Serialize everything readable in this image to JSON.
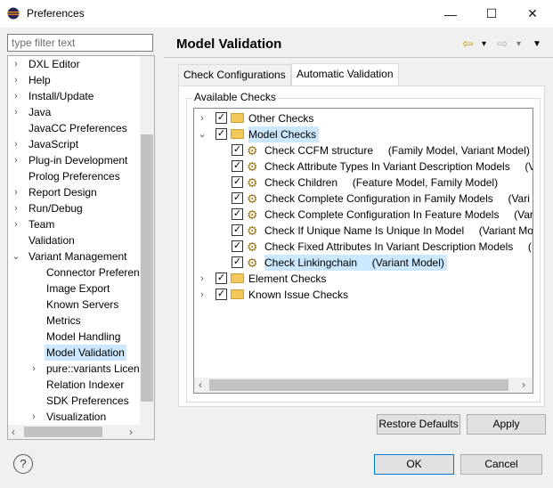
{
  "window": {
    "title": "Preferences",
    "minimize_glyph": "—",
    "maximize_glyph": "☐",
    "close_glyph": "✕"
  },
  "filter": {
    "placeholder": "type filter text"
  },
  "nav_tree": [
    {
      "label": "DXL Editor",
      "chevron": "›"
    },
    {
      "label": "Help",
      "chevron": "›"
    },
    {
      "label": "Install/Update",
      "chevron": "›"
    },
    {
      "label": "Java",
      "chevron": "›"
    },
    {
      "label": "JavaCC Preferences",
      "chevron": ""
    },
    {
      "label": "JavaScript",
      "chevron": "›"
    },
    {
      "label": "Plug-in Development",
      "chevron": "›"
    },
    {
      "label": "Prolog Preferences",
      "chevron": ""
    },
    {
      "label": "Report Design",
      "chevron": "›"
    },
    {
      "label": "Run/Debug",
      "chevron": "›"
    },
    {
      "label": "Team",
      "chevron": "›"
    },
    {
      "label": "Validation",
      "chevron": ""
    },
    {
      "label": "Variant Management",
      "chevron": "⌄"
    },
    {
      "label": "Connector Preferenc",
      "chevron": ""
    },
    {
      "label": "Image Export",
      "chevron": ""
    },
    {
      "label": "Known Servers",
      "chevron": ""
    },
    {
      "label": "Metrics",
      "chevron": ""
    },
    {
      "label": "Model Handling",
      "chevron": ""
    },
    {
      "label": "Model Validation",
      "chevron": ""
    },
    {
      "label": "pure::variants Licens",
      "chevron": "›"
    },
    {
      "label": "Relation Indexer",
      "chevron": ""
    },
    {
      "label": "SDK Preferences",
      "chevron": ""
    },
    {
      "label": "Visualization",
      "chevron": "›"
    }
  ],
  "page": {
    "title": "Model Validation"
  },
  "nav_icons": {
    "back": "⇦",
    "back_menu": "▾",
    "forward": "⇨",
    "forward_menu": "▾",
    "view_menu": "▼"
  },
  "tabs": [
    {
      "label": "Check Configurations"
    },
    {
      "label": "Automatic Validation"
    }
  ],
  "group": {
    "label": "Available Checks"
  },
  "checks_tree": [
    {
      "label": "Other Checks",
      "kind": "folder",
      "chevron": "›",
      "checked": true
    },
    {
      "label": "Model Checks",
      "kind": "folder",
      "chevron": "⌄",
      "checked": true
    },
    {
      "label": "Check CCFM structure     (Family Model, Variant Model)",
      "kind": "check",
      "checked": true
    },
    {
      "label": "Check Attribute Types In Variant Description Models     (V",
      "kind": "check",
      "checked": true
    },
    {
      "label": "Check Children     (Feature Model, Family Model)",
      "kind": "check",
      "checked": true
    },
    {
      "label": "Check Complete Configuration in Family Models     (Vari",
      "kind": "check",
      "checked": true
    },
    {
      "label": "Check Complete Configuration In Feature Models     (Var",
      "kind": "check",
      "checked": true
    },
    {
      "label": "Check If Unique Name Is Unique In Model     (Variant Mo",
      "kind": "check",
      "checked": true
    },
    {
      "label": "Check Fixed Attributes In Variant Description Models     (",
      "kind": "check",
      "checked": true
    },
    {
      "label": "Check Linkingchain     (Variant Model)",
      "kind": "check",
      "checked": true
    },
    {
      "label": "Element Checks",
      "kind": "folder",
      "chevron": "›",
      "checked": true
    },
    {
      "label": "Known Issue Checks",
      "kind": "folder",
      "chevron": "›",
      "checked": true
    }
  ],
  "checkmark": "✓",
  "scroll_arrows": {
    "left": "‹",
    "right": "›"
  },
  "buttons": {
    "restore_defaults": "Restore Defaults",
    "apply": "Apply",
    "ok": "OK",
    "cancel": "Cancel",
    "help": "?"
  }
}
